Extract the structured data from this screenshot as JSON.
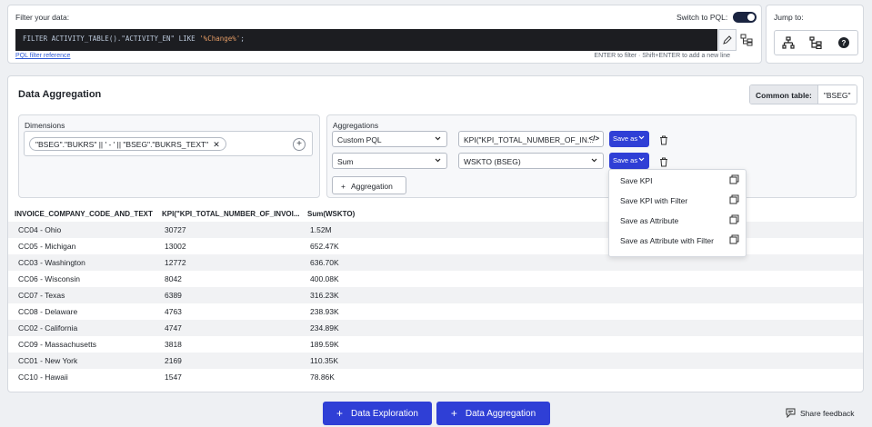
{
  "filter": {
    "label": "Filter your data:",
    "switch_label": "Switch to PQL:",
    "switch_on": true,
    "code_prefix": "FILTER ACTIVITY_TABLE().\"ACTIVITY_EN\" LIKE ",
    "code_string": "'%Change%'",
    "code_suffix": ";",
    "reference_link": "PQL filter reference",
    "hint": "ENTER to filter · Shift+ENTER to add a new line"
  },
  "jump": {
    "label": "Jump to:",
    "icons": [
      "hierarchy-icon",
      "tree-icon",
      "help-icon"
    ]
  },
  "aggregation": {
    "title": "Data Aggregation",
    "common_table_label": "Common table:",
    "common_table_value": "\"BSEG\"",
    "dimensions_title": "Dimensions",
    "dimension_chip": "\"BSEG\".\"BUKRS\" || ' - ' || \"BSEG\".\"BUKRS_TEXT\"",
    "aggregations_title": "Aggregations",
    "rows": [
      {
        "function": "Custom PQL",
        "expression": "KPI(\"KPI_TOTAL_NUMBER_OF_IN...",
        "save_label": "Save as"
      },
      {
        "function": "Sum",
        "expression": "WSKTO (BSEG)",
        "save_label": "Save as"
      }
    ],
    "add_label": "Aggregation"
  },
  "table": {
    "columns": [
      "INVOICE_COMPANY_CODE_AND_TEXT",
      "KPI(\"KPI_TOTAL_NUMBER_OF_INVOI...",
      "Sum(WSKTO)"
    ],
    "rows": [
      [
        "CC04 - Ohio",
        "30727",
        "1.52M"
      ],
      [
        "CC05 - Michigan",
        "13002",
        "652.47K"
      ],
      [
        "CC03 - Washington",
        "12772",
        "636.70K"
      ],
      [
        "CC06 - Wisconsin",
        "8042",
        "400.08K"
      ],
      [
        "CC07 - Texas",
        "6389",
        "316.23K"
      ],
      [
        "CC08 - Delaware",
        "4763",
        "238.93K"
      ],
      [
        "CC02 - California",
        "4747",
        "234.89K"
      ],
      [
        "CC09 - Massachusetts",
        "3818",
        "189.59K"
      ],
      [
        "CC01 - New York",
        "2169",
        "110.35K"
      ],
      [
        "CC10 - Hawaii",
        "1547",
        "78.86K"
      ]
    ]
  },
  "menu": {
    "items": [
      "Save KPI",
      "Save KPI with Filter",
      "Save as Attribute",
      "Save as Attribute with Filter"
    ]
  },
  "bottom": {
    "exploration_label": "Data Exploration",
    "aggregation_label": "Data Aggregation",
    "plus": "+",
    "feedback_label": "Share feedback"
  },
  "colors": {
    "accent": "#2f3fd6",
    "code_bg": "#1c1d21",
    "toggle": "#1a2440"
  }
}
